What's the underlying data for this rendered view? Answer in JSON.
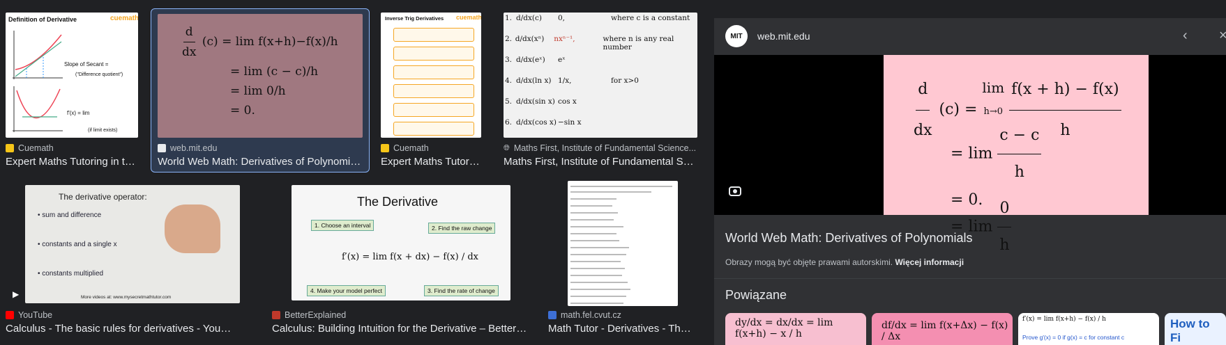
{
  "results": [
    {
      "source": "Cuemath",
      "title": "Expert Maths Tutoring in the..."
    },
    {
      "source": "web.mit.edu",
      "title": "World Web Math: Derivatives of Polynomials"
    },
    {
      "source": "Cuemath",
      "title": "Expert Maths Tutorin..."
    },
    {
      "source": "Maths First, Institute of Fundamental Science...",
      "title": "Maths First, Institute of Fundamental Scie..."
    },
    {
      "source": "YouTube",
      "title": "Calculus - The basic rules for derivatives - YouTube"
    },
    {
      "source": "BetterExplained",
      "title": "Calculus: Building Intuition for the Derivative – BetterEx..."
    },
    {
      "source": "math.fel.cvut.cz",
      "title": "Math Tutor - Derivatives - Theor..."
    }
  ],
  "thumbs": {
    "cuemath1_title": "Definition of Derivative",
    "cuemath1_slope": "Slope of Secant =",
    "cuemath1_dq": "(\"Difference quotient\")",
    "cuemath1_fprime": "f'(x) = lim",
    "cuemath1_exists": "(if limit exists)",
    "brand": "cuemath",
    "cuemath2_title": "Inverse Trig Derivatives",
    "mf_rows": [
      {
        "num": "1.",
        "lhs": "d/dx(c)",
        "rhs": "0,",
        "note": "where c is a constant"
      },
      {
        "num": "2.",
        "lhs": "d/dx(xⁿ)",
        "rhs": "nxⁿ⁻¹,",
        "note": "where n is any real number"
      },
      {
        "num": "3.",
        "lhs": "d/dx(eˣ)",
        "rhs": "eˣ",
        "note": ""
      },
      {
        "num": "4.",
        "lhs": "d/dx(ln x)",
        "rhs": "1/x,",
        "note": "for x>0"
      },
      {
        "num": "5.",
        "lhs": "d/dx(sin x)",
        "rhs": "cos x",
        "note": ""
      },
      {
        "num": "6.",
        "lhs": "d/dx(cos x)",
        "rhs": "−sin x",
        "note": ""
      }
    ],
    "yt_title": "The derivative operator:",
    "yt_line1": "• sum and difference",
    "yt_line2": "• constants and a single x",
    "yt_line3": "• constants multiplied",
    "yt_footer": "More videos at: www.mysecretmathtutor.com",
    "be_title": "The Derivative",
    "be_steps": [
      "1. Choose an interval",
      "2. Find the raw change",
      "4. Make your model perfect",
      "3. Find the rate of change"
    ]
  },
  "panel": {
    "host": "web.mit.edu",
    "logo": "MIT",
    "title": "World Web Math: Derivatives of Polynomials",
    "note": "Obrazy mogą być objęte prawami autorskimi.",
    "more": "Więcej informacji",
    "related": "Powiązane",
    "related_last": "How to Fi Derivativ"
  },
  "colors": {
    "background": "#202124",
    "panel": "#303134",
    "accent": "#8ab4f8",
    "mit_pink": "#ffc8d2",
    "mit_thumb": "#a07880"
  },
  "icons": {
    "back": "chevron-left-icon",
    "close": "close-icon",
    "lens": "lens-icon",
    "play": "play-icon"
  }
}
